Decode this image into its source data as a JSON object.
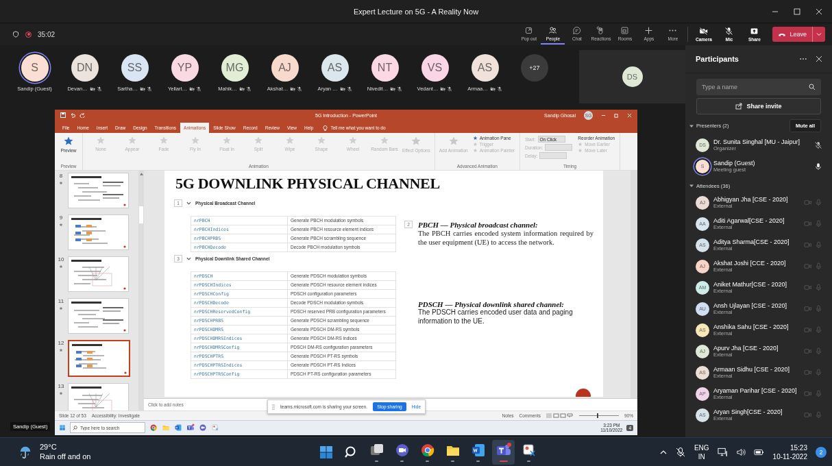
{
  "window": {
    "title": "Expert Lecture on 5G - A Reality Now"
  },
  "meeting_bar": {
    "timer": "35:02",
    "recording": true,
    "view_buttons": [
      {
        "label": "Pop out",
        "kind": "popout",
        "selected": false
      },
      {
        "label": "People",
        "kind": "people",
        "selected": true
      },
      {
        "label": "Chat",
        "kind": "chat",
        "selected": false
      },
      {
        "label": "Reactions",
        "kind": "reactions",
        "selected": false
      },
      {
        "label": "Rooms",
        "kind": "rooms",
        "selected": false
      },
      {
        "label": "Apps",
        "kind": "apps",
        "selected": false
      },
      {
        "label": "More",
        "kind": "more",
        "selected": false
      }
    ],
    "device_buttons": [
      {
        "label": "Camera",
        "kind": "camera_off"
      },
      {
        "label": "Mic",
        "kind": "mic_off"
      },
      {
        "label": "Share",
        "kind": "share"
      }
    ],
    "leave": "Leave"
  },
  "participant_strip": {
    "tiles": [
      {
        "initials": "S",
        "name": "Sandip (Guest)",
        "color": "#fbdfd4",
        "active": true,
        "muted": false
      },
      {
        "initials": "DN",
        "name": "Devan…",
        "color": "#ece3dc",
        "active": false,
        "muted": true
      },
      {
        "initials": "SS",
        "name": "Sartha…",
        "color": "#d9e5f3",
        "active": false,
        "muted": true
      },
      {
        "initials": "YP",
        "name": "Yellart…",
        "color": "#fad9e3",
        "active": false,
        "muted": true
      },
      {
        "initials": "MG",
        "name": "Mahik…",
        "color": "#e2edd6",
        "active": false,
        "muted": true
      },
      {
        "initials": "AJ",
        "name": "Akshat…",
        "color": "#f8dacd",
        "active": false,
        "muted": true
      },
      {
        "initials": "AS",
        "name": "Aryan …",
        "color": "#dbe7ec",
        "active": false,
        "muted": true
      },
      {
        "initials": "NT",
        "name": "Nivedit…",
        "color": "#fbd8e4",
        "active": false,
        "muted": true
      },
      {
        "initials": "VS",
        "name": "Vedant…",
        "color": "#f9d5e6",
        "active": false,
        "muted": true
      },
      {
        "initials": "AS",
        "name": "Armaa…",
        "color": "#f0e2da",
        "active": false,
        "muted": true
      }
    ],
    "overflow": "+27",
    "screen_tile": {
      "initials": "DS",
      "color": "#dfe8d6"
    },
    "self_label": "Sandip (Guest)"
  },
  "shared_screen": {
    "powerpoint": {
      "title": "5G Introduction - PowerPoint",
      "user": "Sandip Ghosal",
      "user_initials": "SG",
      "tabs": [
        {
          "label": "File",
          "selected": false
        },
        {
          "label": "Home",
          "selected": false
        },
        {
          "label": "Insert",
          "selected": false
        },
        {
          "label": "Draw",
          "selected": false
        },
        {
          "label": "Design",
          "selected": false
        },
        {
          "label": "Transitions",
          "selected": false
        },
        {
          "label": "Animations",
          "selected": true
        },
        {
          "label": "Slide Show",
          "selected": false
        },
        {
          "label": "Record",
          "selected": false
        },
        {
          "label": "Review",
          "selected": false
        },
        {
          "label": "View",
          "selected": false
        },
        {
          "label": "Help",
          "selected": false
        }
      ],
      "tell_me": "Tell me what you want to do",
      "ribbon": [
        {
          "label": "Preview",
          "items": [
            {
              "label": "Preview",
              "kind": "large",
              "disabled": false
            }
          ]
        },
        {
          "label": "Animation",
          "items": [
            {
              "label": "None",
              "kind": "effect",
              "disabled": true
            },
            {
              "label": "Appear",
              "kind": "effect",
              "disabled": true
            },
            {
              "label": "Fade",
              "kind": "effect",
              "disabled": true
            },
            {
              "label": "Fly In",
              "kind": "effect",
              "disabled": true
            },
            {
              "label": "Float In",
              "kind": "effect",
              "disabled": true
            },
            {
              "label": "Split",
              "kind": "effect",
              "disabled": true
            },
            {
              "label": "Wipe",
              "kind": "effect",
              "disabled": true
            },
            {
              "label": "Shape",
              "kind": "effect",
              "disabled": true
            },
            {
              "label": "Wheel",
              "kind": "effect",
              "disabled": true
            },
            {
              "label": "Random Bars",
              "kind": "effect",
              "disabled": true
            },
            {
              "label": "Effect Options",
              "kind": "large",
              "disabled": true
            }
          ]
        },
        {
          "label": "Advanced Animation",
          "items": [
            {
              "label": "Add Animation",
              "kind": "large",
              "disabled": true
            },
            {
              "label": "Animation Pane",
              "kind": "small",
              "disabled": false
            },
            {
              "label": "Trigger",
              "kind": "small",
              "disabled": true
            },
            {
              "label": "Animation Painter",
              "kind": "small",
              "disabled": true
            }
          ]
        },
        {
          "label": "Timing",
          "items": [
            {
              "label": "Start:",
              "kind": "field",
              "disabled": true,
              "value": "On Click"
            },
            {
              "label": "Duration:",
              "kind": "field",
              "disabled": true
            },
            {
              "label": "Delay:",
              "kind": "field",
              "disabled": true
            },
            {
              "label": "Reorder Animation",
              "kind": "heading",
              "disabled": false
            },
            {
              "label": "Move Earlier",
              "kind": "small",
              "disabled": true
            },
            {
              "label": "Move Later",
              "kind": "small",
              "disabled": true
            }
          ]
        }
      ],
      "slides": [
        {
          "number": "8",
          "selected": false
        },
        {
          "number": "9",
          "selected": false
        },
        {
          "number": "10",
          "selected": false
        },
        {
          "number": "11",
          "selected": false
        },
        {
          "number": "12",
          "selected": true
        },
        {
          "number": "13",
          "selected": false
        }
      ],
      "slide": {
        "title": "5G DOWNLINK PHYSICAL CHANNEL",
        "sections": [
          {
            "marker": "1",
            "heading": "Physical Broadcast Channel",
            "expanded": true,
            "rows": [
              {
                "function": "nrPBCH",
                "description": "Generate PBCH modulation symbols"
              },
              {
                "function": "nrPBCHIndices",
                "description": "Generate PBCH resource element indices"
              },
              {
                "function": "nrPBCHPRBS",
                "description": "Generate PBCH scrambling sequence"
              },
              {
                "function": "nrPBCHDecode",
                "description": "Decode PBCH modulation symbols"
              }
            ]
          },
          {
            "marker": "3",
            "heading": "Physical Downlink Shared Channel",
            "expanded": true,
            "rows": [
              {
                "function": "nrPDSCH",
                "description": "Generate PDSCH modulation symbols"
              },
              {
                "function": "nrPDSCHIndices",
                "description": "Generate PDSCH resource element indices"
              },
              {
                "function": "nrPDSCHConfig",
                "description": "PDSCH configuration parameters"
              },
              {
                "function": "nrPDSCHDecode",
                "description": "Decode PDSCH modulation symbols"
              },
              {
                "function": "nrPDSCHReservedConfig",
                "description": "PDSCH reserved PRB configuration parameters"
              },
              {
                "function": "nrPDSCHPRBS",
                "description": "Generate PDSCH scrambling sequence"
              },
              {
                "function": "nrPDSCHDMRS",
                "description": "Generate PDSCH DM-RS symbols"
              },
              {
                "function": "nrPDSCHDMRSIndices",
                "description": "Generate PDSCH DM-RS indices"
              },
              {
                "function": "nrPDSCHDMRSConfig",
                "description": "PDSCH DM-RS configuration parameters"
              },
              {
                "function": "nrPDSCHPTRS",
                "description": "Generate PDSCH PT-RS symbols"
              },
              {
                "function": "nrPDSCHPTRSIndices",
                "description": "Generate PDSCH PT-RS Indices"
              },
              {
                "function": "nrPDSCHPTRSConfig",
                "description": "PDSCH PT-RS configuration parameters"
              }
            ]
          }
        ],
        "notes": [
          {
            "marker": "2",
            "heading": "PBCH — Physical broadcast channel:",
            "body": "The PBCH carries encoded system information required by the user equipment (UE) to access the network.",
            "kind": "serif"
          },
          {
            "heading": "PDSCH — Physical downlink shared channel:",
            "body": "The PDSCH carries encoded user data and paging information to the UE.",
            "kind": "sans"
          }
        ]
      },
      "notes_placeholder": "Click to add notes",
      "status": {
        "slide_count": "Slide 12 of 53",
        "accessibility": "Accessibility: Investigate",
        "notes": "Notes",
        "comments": "Comments",
        "zoom": "90%",
        "level": 0.45
      }
    },
    "sharing_bar": {
      "message": "teams.microsoft.com is sharing your screen.",
      "stop": "Stop sharing",
      "hide": "Hide"
    },
    "taskbar": {
      "search": {
        "placeholder": "Type here to search"
      },
      "time": "3:23 PM",
      "date": "11/10/2022",
      "notifications": "4"
    }
  },
  "participants_panel": {
    "title": "Participants",
    "search": {
      "placeholder": "Type a name"
    },
    "share_invite": "Share invite",
    "groups": [
      {
        "label": "Presenters (2)",
        "expanded": true,
        "action": "Mute all",
        "people": [
          {
            "initials": "DS",
            "name": "Dr. Sunita Singhal [MU - Jaipur]",
            "role": "Organizer",
            "color": "#dfe8d6",
            "active": false,
            "kind": "muted"
          },
          {
            "initials": "S",
            "name": "Sandip (Guest)",
            "role": "Meeting guest",
            "color": "#fbdfd4",
            "active": true,
            "kind": "speaking"
          }
        ]
      },
      {
        "label": "Attendees (36)",
        "expanded": true,
        "people": [
          {
            "initials": "AJ",
            "name": "Abhigyan Jha [CSE - 2020]",
            "role": "External",
            "color": "#eddcd5",
            "active": false,
            "kind": "attendee"
          },
          {
            "initials": "AA",
            "name": "Aditi Agarwal[CSE - 2020]",
            "role": "External",
            "color": "#d8e5f0",
            "active": false,
            "kind": "attendee"
          },
          {
            "initials": "AS",
            "name": "Aditya Sharma[CSE - 2020]",
            "role": "External",
            "color": "#d6e2e9",
            "active": false,
            "kind": "attendee"
          },
          {
            "initials": "AJ",
            "name": "Akshat Joshi [CCE - 2020]",
            "role": "External",
            "color": "#f7d3c8",
            "active": false,
            "kind": "attendee"
          },
          {
            "initials": "AM",
            "name": "Aniket Mathur[CSE - 2020]",
            "role": "External",
            "color": "#cdebe7",
            "active": false,
            "kind": "attendee"
          },
          {
            "initials": "AU",
            "name": "Ansh Ujlayan [CSE - 2020]",
            "role": "External",
            "color": "#d0ddf2",
            "active": false,
            "kind": "attendee"
          },
          {
            "initials": "AS",
            "name": "Anshika Sahu [CSE - 2020]",
            "role": "External",
            "color": "#f8e8b9",
            "active": false,
            "kind": "attendee"
          },
          {
            "initials": "AJ",
            "name": "Apurv Jha [CSE - 2020]",
            "role": "External",
            "color": "#dfe8d9",
            "active": false,
            "kind": "attendee"
          },
          {
            "initials": "AS",
            "name": "Armaan Sidhu [CSE - 2020]",
            "role": "External",
            "color": "#ebdfd8",
            "active": false,
            "kind": "attendee"
          },
          {
            "initials": "AP",
            "name": "Aryaman Parihar [CSE - 2020]",
            "role": "External",
            "color": "#f2d4ea",
            "active": false,
            "kind": "attendee"
          },
          {
            "initials": "AS",
            "name": "Aryan Singh[CSE - 2020]",
            "role": "External",
            "color": "#d8e2e9",
            "active": false,
            "kind": "attendee"
          }
        ]
      }
    ]
  },
  "taskbar": {
    "weather": {
      "temperature": "29°C",
      "condition": "Rain off and on"
    },
    "apps": [
      {
        "kind": "start",
        "selected": false
      },
      {
        "kind": "search",
        "selected": false
      },
      {
        "kind": "taskview",
        "selected": false
      },
      {
        "kind": "meet",
        "selected": false
      },
      {
        "kind": "chrome",
        "selected": false
      },
      {
        "kind": "explorer",
        "selected": false
      },
      {
        "kind": "word",
        "selected": false
      },
      {
        "kind": "teams",
        "selected": true
      },
      {
        "kind": "snip",
        "selected": false
      }
    ],
    "language": "ENG",
    "region": "IN",
    "time": "15:23",
    "date": "10-11-2022",
    "notifications": "2"
  }
}
